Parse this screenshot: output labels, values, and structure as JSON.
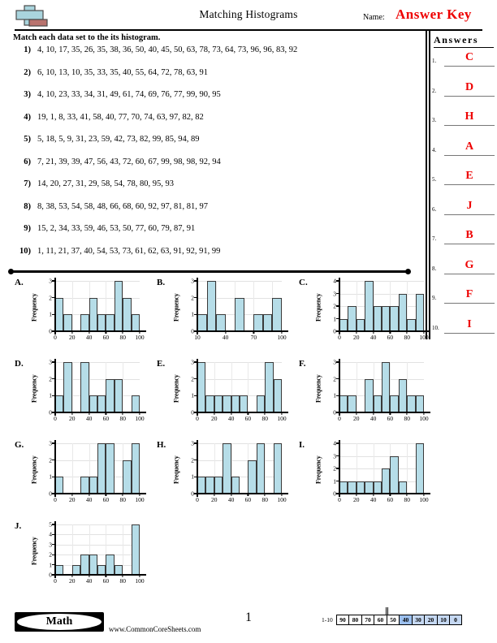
{
  "header": {
    "title": "Matching Histograms",
    "name_label": "Name:",
    "answer_key": "Answer Key",
    "logo": "plus-block-logo"
  },
  "instructions": "Match each data set to the its histogram.",
  "problems": [
    {
      "num": "1)",
      "data": "4, 10, 17, 35, 26, 35, 38, 36, 50, 40, 45, 50, 63, 78, 73, 64, 73, 96, 96, 83, 92"
    },
    {
      "num": "2)",
      "data": "6, 10, 13, 10, 35, 33, 35, 40, 55, 64, 72, 78, 63, 91"
    },
    {
      "num": "3)",
      "data": "4, 10, 23, 33, 34, 31, 49, 61, 74, 69, 76, 77, 99, 90, 95"
    },
    {
      "num": "4)",
      "data": "19, 1, 8, 33, 41, 58, 40, 77, 70, 74, 63, 97, 82, 82"
    },
    {
      "num": "5)",
      "data": "5, 18, 5, 9, 31, 23, 59, 42, 73, 82, 99, 85, 94, 89"
    },
    {
      "num": "6)",
      "data": "7, 21, 39, 39, 47, 56, 43, 72, 60, 67, 99, 98, 98, 92, 94"
    },
    {
      "num": "7)",
      "data": "14, 20, 27, 31, 29, 58, 54, 78, 80, 95, 93"
    },
    {
      "num": "8)",
      "data": "8, 38, 53, 54, 58, 48, 66, 68, 60, 92, 97, 81, 81, 97"
    },
    {
      "num": "9)",
      "data": "15, 2, 34, 33, 59, 46, 53, 50, 77, 60, 79, 87, 91"
    },
    {
      "num": "10)",
      "data": "1, 11, 21, 37, 40, 54, 53, 73, 61, 62, 63, 91, 92, 91, 99"
    }
  ],
  "answers_panel": {
    "title": "Answers",
    "items": [
      {
        "num": "1.",
        "value": "C"
      },
      {
        "num": "2.",
        "value": "D"
      },
      {
        "num": "3.",
        "value": "H"
      },
      {
        "num": "4.",
        "value": "A"
      },
      {
        "num": "5.",
        "value": "E"
      },
      {
        "num": "6.",
        "value": "J"
      },
      {
        "num": "7.",
        "value": "B"
      },
      {
        "num": "8.",
        "value": "G"
      },
      {
        "num": "9.",
        "value": "F"
      },
      {
        "num": "10.",
        "value": "I"
      }
    ]
  },
  "chart_data": [
    {
      "id": "A",
      "letter": "A.",
      "type": "bar",
      "ylabel": "Frequency",
      "categories": [
        "0-10",
        "10-20",
        "20-30",
        "30-40",
        "40-50",
        "50-60",
        "60-70",
        "70-80",
        "80-90",
        "90-100"
      ],
      "values": [
        2,
        1,
        0,
        1,
        2,
        1,
        1,
        3,
        2,
        1
      ],
      "ylim": [
        0,
        3
      ],
      "yticks": [
        0,
        1,
        2,
        3
      ],
      "xticks": [
        "0",
        "20",
        "40",
        "60",
        "80",
        "100"
      ],
      "xlim": [
        0,
        100
      ],
      "bin_width": 10,
      "grid": true
    },
    {
      "id": "B",
      "letter": "B.",
      "type": "bar",
      "ylabel": "Frequency",
      "categories": [
        "10-20",
        "20-30",
        "30-40",
        "40-50",
        "50-60",
        "60-70",
        "70-80",
        "80-90",
        "90-100"
      ],
      "values": [
        1,
        3,
        1,
        0,
        2,
        0,
        1,
        1,
        2
      ],
      "ylim": [
        0,
        3
      ],
      "yticks": [
        0,
        1,
        2,
        3
      ],
      "xticks": [
        "10",
        "40",
        "70",
        "100"
      ],
      "xlim": [
        10,
        100
      ],
      "bin_width": 10,
      "grid": true
    },
    {
      "id": "C",
      "letter": "C.",
      "type": "bar",
      "ylabel": "Frequency",
      "categories": [
        "0-10",
        "10-20",
        "20-30",
        "30-40",
        "40-50",
        "50-60",
        "60-70",
        "70-80",
        "80-90",
        "90-100"
      ],
      "values": [
        1,
        2,
        1,
        4,
        2,
        2,
        2,
        3,
        1,
        3
      ],
      "ylim": [
        0,
        4
      ],
      "yticks": [
        0,
        1,
        2,
        3,
        4
      ],
      "xticks": [
        "0",
        "20",
        "40",
        "60",
        "80",
        "100"
      ],
      "xlim": [
        0,
        100
      ],
      "bin_width": 10,
      "grid": true
    },
    {
      "id": "D",
      "letter": "D.",
      "type": "bar",
      "ylabel": "Frequency",
      "categories": [
        "0-10",
        "10-20",
        "20-30",
        "30-40",
        "40-50",
        "50-60",
        "60-70",
        "70-80",
        "80-90",
        "90-100"
      ],
      "values": [
        1,
        3,
        0,
        3,
        1,
        1,
        2,
        2,
        0,
        1
      ],
      "ylim": [
        0,
        3
      ],
      "yticks": [
        0,
        1,
        2,
        3
      ],
      "xticks": [
        "0",
        "20",
        "40",
        "60",
        "80",
        "100"
      ],
      "xlim": [
        0,
        100
      ],
      "bin_width": 10,
      "grid": true
    },
    {
      "id": "E",
      "letter": "E.",
      "type": "bar",
      "ylabel": "Frequency",
      "categories": [
        "0-10",
        "10-20",
        "20-30",
        "30-40",
        "40-50",
        "50-60",
        "60-70",
        "70-80",
        "80-90",
        "90-100"
      ],
      "values": [
        3,
        1,
        1,
        1,
        1,
        1,
        0,
        1,
        3,
        2
      ],
      "ylim": [
        0,
        3
      ],
      "yticks": [
        0,
        1,
        2,
        3
      ],
      "xticks": [
        "0",
        "20",
        "40",
        "60",
        "80",
        "100"
      ],
      "xlim": [
        0,
        100
      ],
      "bin_width": 10,
      "grid": true
    },
    {
      "id": "F",
      "letter": "F.",
      "type": "bar",
      "ylabel": "Frequency",
      "categories": [
        "0-10",
        "10-20",
        "20-30",
        "30-40",
        "40-50",
        "50-60",
        "60-70",
        "70-80",
        "80-90",
        "90-100"
      ],
      "values": [
        1,
        1,
        0,
        2,
        1,
        3,
        1,
        2,
        1,
        1
      ],
      "ylim": [
        0,
        3
      ],
      "yticks": [
        0,
        1,
        2,
        3
      ],
      "xticks": [
        "0",
        "20",
        "40",
        "60",
        "80",
        "100"
      ],
      "xlim": [
        0,
        100
      ],
      "bin_width": 10,
      "grid": true
    },
    {
      "id": "G",
      "letter": "G.",
      "type": "bar",
      "ylabel": "Frequency",
      "categories": [
        "0-10",
        "10-20",
        "20-30",
        "30-40",
        "40-50",
        "50-60",
        "60-70",
        "70-80",
        "80-90",
        "90-100"
      ],
      "values": [
        1,
        0,
        0,
        1,
        1,
        3,
        3,
        0,
        2,
        3
      ],
      "ylim": [
        0,
        3
      ],
      "yticks": [
        0,
        1,
        2,
        3
      ],
      "xticks": [
        "0",
        "20",
        "40",
        "60",
        "80",
        "100"
      ],
      "xlim": [
        0,
        100
      ],
      "bin_width": 10,
      "grid": true
    },
    {
      "id": "H",
      "letter": "H.",
      "type": "bar",
      "ylabel": "Frequency",
      "categories": [
        "0-10",
        "10-20",
        "20-30",
        "30-40",
        "40-50",
        "50-60",
        "60-70",
        "70-80",
        "80-90",
        "90-100"
      ],
      "values": [
        1,
        1,
        1,
        3,
        1,
        0,
        2,
        3,
        0,
        3
      ],
      "ylim": [
        0,
        3
      ],
      "yticks": [
        0,
        1,
        2,
        3
      ],
      "xticks": [
        "0",
        "20",
        "40",
        "60",
        "80",
        "100"
      ],
      "xlim": [
        0,
        100
      ],
      "bin_width": 10,
      "grid": true
    },
    {
      "id": "I",
      "letter": "I.",
      "type": "bar",
      "ylabel": "Frequency",
      "categories": [
        "0-10",
        "10-20",
        "20-30",
        "30-40",
        "40-50",
        "50-60",
        "60-70",
        "70-80",
        "80-90",
        "90-100"
      ],
      "values": [
        1,
        1,
        1,
        1,
        1,
        2,
        3,
        1,
        0,
        4
      ],
      "ylim": [
        0,
        4
      ],
      "yticks": [
        0,
        1,
        2,
        3,
        4
      ],
      "xticks": [
        "0",
        "20",
        "40",
        "60",
        "80",
        "100"
      ],
      "xlim": [
        0,
        100
      ],
      "bin_width": 10,
      "grid": true
    },
    {
      "id": "J",
      "letter": "J.",
      "type": "bar",
      "ylabel": "Frequency",
      "categories": [
        "0-10",
        "10-20",
        "20-30",
        "30-40",
        "40-50",
        "50-60",
        "60-70",
        "70-80",
        "80-90",
        "90-100"
      ],
      "values": [
        1,
        0,
        1,
        2,
        2,
        1,
        2,
        1,
        0,
        5
      ],
      "ylim": [
        0,
        5
      ],
      "yticks": [
        0,
        1,
        2,
        3,
        4,
        5
      ],
      "xticks": [
        "0",
        "20",
        "40",
        "60",
        "80",
        "100"
      ],
      "xlim": [
        0,
        100
      ],
      "bin_width": 10,
      "grid": true
    }
  ],
  "footer": {
    "brand": "Math",
    "url": "www.CommonCoreSheets.com",
    "page_number": "1",
    "scale_label": "1-10",
    "scale_cells": [
      {
        "value": "90",
        "state": "plain"
      },
      {
        "value": "80",
        "state": "plain"
      },
      {
        "value": "70",
        "state": "plain"
      },
      {
        "value": "60",
        "state": "plain"
      },
      {
        "value": "50",
        "state": "plain"
      },
      {
        "value": "40",
        "state": "dark"
      },
      {
        "value": "30",
        "state": "light"
      },
      {
        "value": "20",
        "state": "light"
      },
      {
        "value": "10",
        "state": "light"
      },
      {
        "value": "0",
        "state": "light"
      }
    ]
  },
  "colors": {
    "bar_fill": "#b6dde8",
    "bar_stroke": "#3a3a3a",
    "answer_red": "#ee0000",
    "logo_blue": "#a9d4dd",
    "logo_red": "#b9736e"
  }
}
